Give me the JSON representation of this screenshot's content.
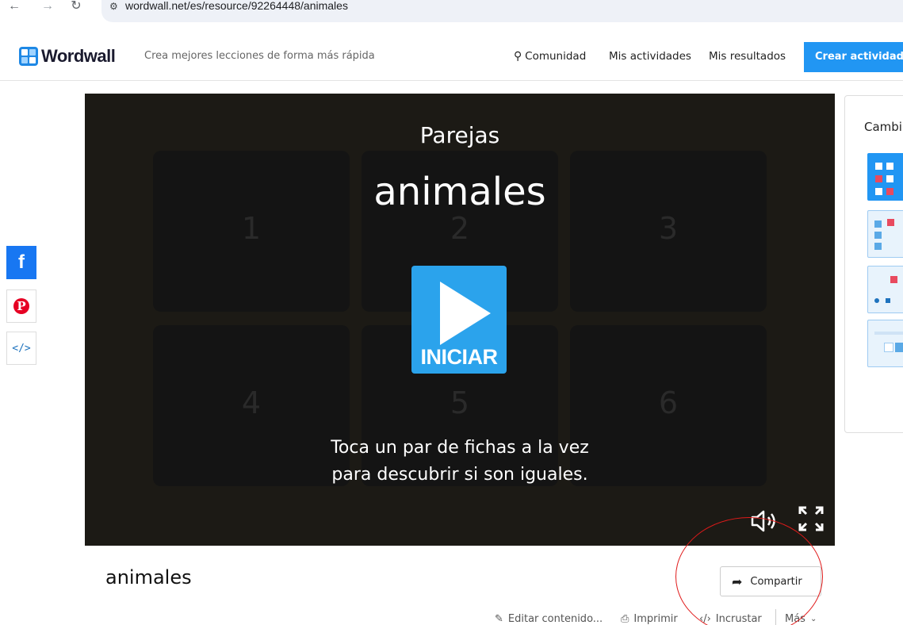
{
  "browser": {
    "back": "←",
    "forward": "→",
    "reload": "↻",
    "url": "wordwall.net/es/resource/92264448/animales"
  },
  "header": {
    "logo_text": "Wordwall",
    "tagline": "Crea mejores lecciones de forma más rápida",
    "nav": {
      "community": "Comunidad",
      "my_activities": "Mis actividades",
      "my_results": "Mis resultados"
    },
    "create_button": "Crear actividad",
    "colors": {
      "brand": "#2196f3"
    }
  },
  "social": {
    "facebook": "f",
    "pinterest": "P",
    "embed": "</>"
  },
  "game": {
    "template": "Parejas",
    "name": "animales",
    "tiles": [
      "1",
      "2",
      "3",
      "4",
      "5",
      "6"
    ],
    "start_label": "INICIAR",
    "instructions_line1": "Toca un par de fichas a la vez",
    "instructions_line2": "para descubrir si son iguales."
  },
  "activity": {
    "title": "animales",
    "share_label": "Compartir",
    "tools": {
      "edit": "Editar contenido...",
      "print": "Imprimir",
      "embed": "Incrustar",
      "more": "Más"
    }
  },
  "right_panel": {
    "title": "Cambi"
  },
  "annotation": {
    "color": "#e01a1a"
  }
}
